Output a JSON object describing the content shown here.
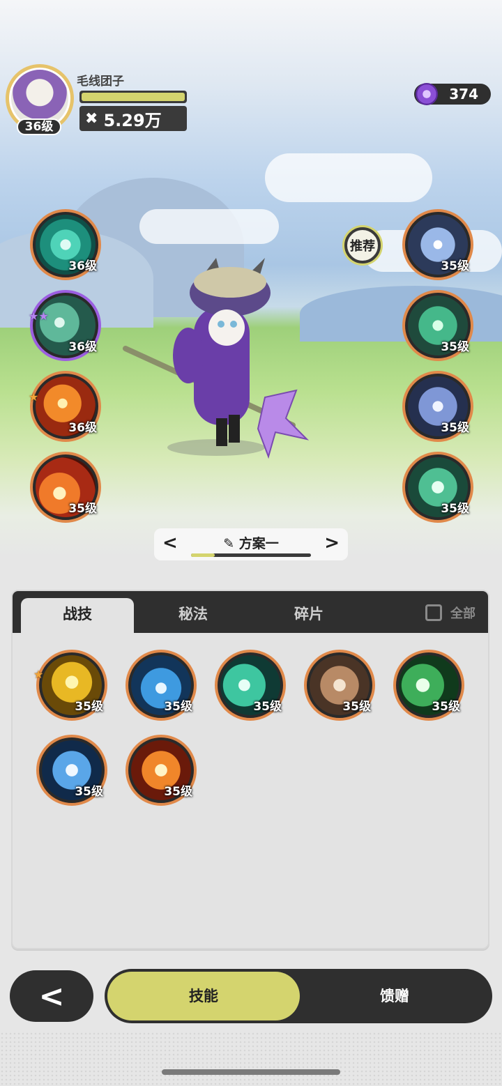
{
  "player": {
    "name": "毛线团子",
    "level": "36级",
    "exp_fraction": 1.0,
    "power": "5.29万",
    "power_icon": "crossed-tools-icon"
  },
  "currency": {
    "amount": "374",
    "icon": "purple-gem-icon"
  },
  "recommend_label": "推荐",
  "left_skills": [
    {
      "level": "36级",
      "icon": "teal-swirl-icon",
      "badge": ""
    },
    {
      "level": "36级",
      "icon": "thorn-vine-icon",
      "badge": "star-purple"
    },
    {
      "level": "36级",
      "icon": "fire-swirl-icon",
      "badge": "star-gold"
    },
    {
      "level": "35级",
      "icon": "flame-icon",
      "badge": ""
    }
  ],
  "right_skills": [
    {
      "level": "35级",
      "icon": "sparkle-orb-icon"
    },
    {
      "level": "35级",
      "icon": "green-burst-icon"
    },
    {
      "level": "35级",
      "icon": "blue-crystal-orb-icon"
    },
    {
      "level": "35级",
      "icon": "shield-orb-icon"
    }
  ],
  "plan": {
    "title": "方案一",
    "prev": "<",
    "next": ">",
    "progress": 0.2,
    "edit_icon": "pencil-icon"
  },
  "tabs": [
    {
      "label": "战技",
      "active": true
    },
    {
      "label": "秘法",
      "active": false
    },
    {
      "label": "碎片",
      "active": false
    }
  ],
  "all_toggle_label": "全部",
  "grid_skills": [
    {
      "level": "35级",
      "icon": "golden-crystal-icon",
      "badge": "star-gold"
    },
    {
      "level": "35级",
      "icon": "blue-wave-icon",
      "badge": ""
    },
    {
      "level": "35级",
      "icon": "green-slash-icon",
      "badge": ""
    },
    {
      "level": "35级",
      "icon": "card-stack-icon",
      "badge": ""
    },
    {
      "level": "35级",
      "icon": "green-cross-icon",
      "badge": ""
    },
    {
      "level": "35级",
      "icon": "ice-shard-icon",
      "badge": ""
    },
    {
      "level": "35级",
      "icon": "fire-vortex-icon",
      "badge": ""
    }
  ],
  "nav": {
    "back": "<",
    "skills": "技能",
    "gift": "馈赠"
  }
}
